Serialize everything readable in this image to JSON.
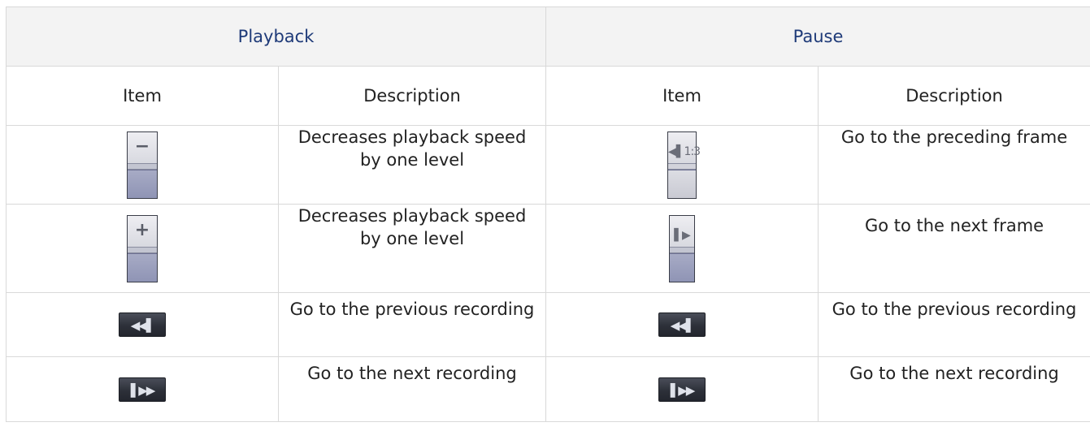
{
  "table": {
    "groups": {
      "playback": "Playback",
      "pause": "Pause"
    },
    "columns": {
      "playback_item": "Item",
      "playback_description": "Description",
      "pause_item": "Item",
      "pause_description": "Description"
    },
    "rows": [
      {
        "playback_icon": "speed-down-icon",
        "playback_icon_glyph": "−",
        "playback_desc": "Decreases playback speed by one level",
        "pause_icon": "previous-frame-icon",
        "pause_icon_glyph": "◀▌1:3",
        "pause_desc": "Go to the preceding frame"
      },
      {
        "playback_icon": "speed-up-icon",
        "playback_icon_glyph": "+",
        "playback_desc": "Decreases playback speed by one level",
        "pause_icon": "next-frame-icon",
        "pause_icon_glyph": "▌▶",
        "pause_desc": "Go to the next frame"
      },
      {
        "playback_icon": "previous-recording-icon",
        "playback_icon_glyph": "◀◀▌",
        "playback_desc": "Go to the previous recording",
        "pause_icon": "previous-recording-icon",
        "pause_icon_glyph": "◀◀▌",
        "pause_desc": "Go to the previous recording"
      },
      {
        "playback_icon": "next-recording-icon",
        "playback_icon_glyph": "▌▶▶",
        "playback_desc": "Go to the next recording",
        "pause_icon": "next-recording-icon",
        "pause_icon_glyph": "▌▶▶",
        "pause_desc": "Go to the next recording"
      }
    ]
  },
  "colors": {
    "group_header_text": "#1e3a78",
    "group_header_bg": "#f3f3f3",
    "border": "#d9d9d9"
  }
}
